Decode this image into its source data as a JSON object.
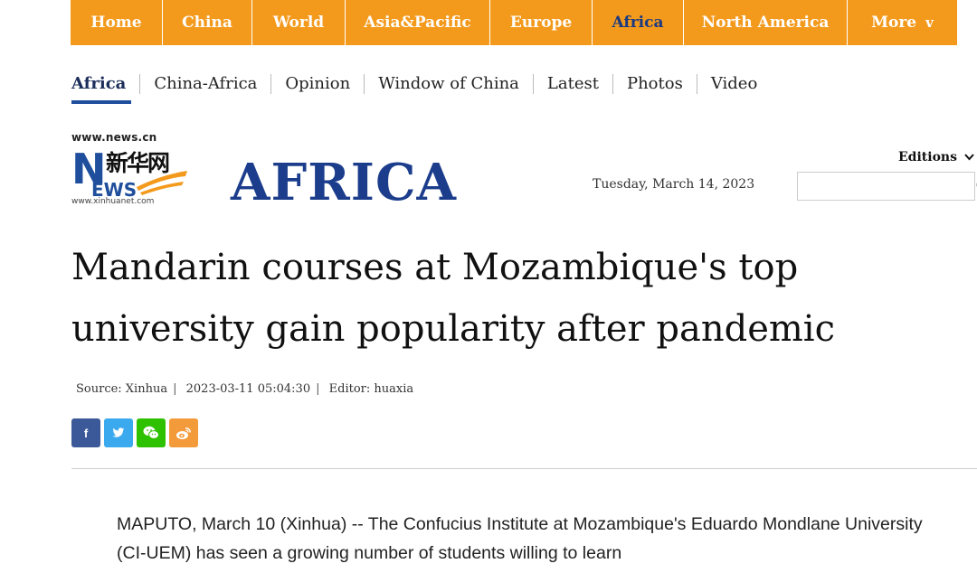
{
  "topnav": {
    "items": [
      {
        "label": "Home"
      },
      {
        "label": "China"
      },
      {
        "label": "World"
      },
      {
        "label": "Asia&Pacific"
      },
      {
        "label": "Europe"
      },
      {
        "label": "Africa"
      },
      {
        "label": "North America"
      },
      {
        "label": "More"
      }
    ],
    "active_color": "#1b3a80",
    "bar_color": "#f39a1d"
  },
  "subnav": {
    "items": [
      {
        "label": "Africa"
      },
      {
        "label": "China-Africa"
      },
      {
        "label": "Opinion"
      },
      {
        "label": "Window of China"
      },
      {
        "label": "Latest"
      },
      {
        "label": "Photos"
      },
      {
        "label": "Video"
      }
    ]
  },
  "logo": {
    "url_top": "www.news.cn",
    "chinese": "新华网",
    "url_bottom": "www.xinhuanet.com",
    "letter_n": "N",
    "letters_ews": "EWS"
  },
  "section_title": "AFRICA",
  "date": "Tuesday, March  14, 2023",
  "editions": {
    "label": "Editions",
    "icon": "chevron-down-icon"
  },
  "search": {
    "placeholder": "",
    "value": "",
    "icon": "search-icon"
  },
  "article": {
    "headline": "Mandarin courses at Mozambique's top university gain popularity after pandemic",
    "source": "Source: Xinhua",
    "datetime": "2023-03-11 05:04:30",
    "editor": "Editor: huaxia",
    "body": "MAPUTO, March 10 (Xinhua) -- The Confucius Institute at Mozambique's Eduardo Mondlane University (CI-UEM) has seen a growing number of students willing to learn"
  },
  "share": [
    {
      "icon": "facebook-icon",
      "glyph": "f",
      "color": "#3b5998"
    },
    {
      "icon": "twitter-icon",
      "glyph": "",
      "color": "#3ba9ee"
    },
    {
      "icon": "wechat-icon",
      "glyph": "",
      "color": "#2dc100"
    },
    {
      "icon": "weibo-icon",
      "glyph": "",
      "color": "#f39a3a"
    }
  ]
}
